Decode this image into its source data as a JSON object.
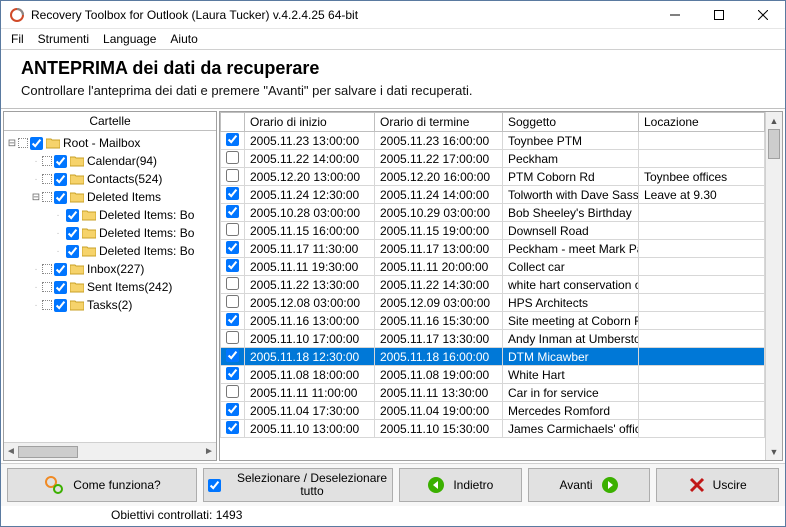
{
  "window": {
    "title": "Recovery Toolbox for Outlook (Laura Tucker) v.4.2.4.25 64-bit"
  },
  "menu": {
    "file": "Fil",
    "tools": "Strumenti",
    "language": "Language",
    "help": "Aiuto"
  },
  "header": {
    "title": "ANTEPRIMA dei dati da recuperare",
    "subtitle": "Controllare l'anteprima dei dati e premere \"Avanti\" per salvare i dati recuperati."
  },
  "tree": {
    "header": "Cartelle",
    "root": "Root - Mailbox",
    "items": [
      {
        "label": "Calendar",
        "count": "  (94)",
        "indent": 1
      },
      {
        "label": "Contacts",
        "count": "  (524)",
        "indent": 1
      },
      {
        "label": "Deleted Items",
        "count": "",
        "indent": 1,
        "expandable": true
      },
      {
        "label": "Deleted Items: Bo",
        "count": "",
        "indent": 2
      },
      {
        "label": "Deleted Items: Bo",
        "count": "",
        "indent": 2
      },
      {
        "label": "Deleted Items: Bo",
        "count": "",
        "indent": 2
      },
      {
        "label": "Inbox",
        "count": "  (227)",
        "indent": 1
      },
      {
        "label": "Sent Items",
        "count": "  (242)",
        "indent": 1
      },
      {
        "label": "Tasks",
        "count": "  (2)",
        "indent": 1
      }
    ]
  },
  "grid": {
    "cols": {
      "start": "Orario di inizio",
      "end": "Orario di termine",
      "subject": "Soggetto",
      "location": "Locazione"
    },
    "rows": [
      {
        "chk": true,
        "start": "2005.11.23 13:00:00",
        "end": "2005.11.23 16:00:00",
        "subject": "Toynbee PTM",
        "location": ""
      },
      {
        "chk": false,
        "start": "2005.11.22 14:00:00",
        "end": "2005.11.22 17:00:00",
        "subject": "Peckham",
        "location": ""
      },
      {
        "chk": false,
        "start": "2005.12.20 13:00:00",
        "end": "2005.12.20 16:00:00",
        "subject": "PTM Coborn Rd",
        "location": "Toynbee offices"
      },
      {
        "chk": true,
        "start": "2005.11.24 12:30:00",
        "end": "2005.11.24 14:00:00",
        "subject": "Tolworth with Dave Sasse",
        "location": "Leave at 9.30"
      },
      {
        "chk": true,
        "start": "2005.10.28 03:00:00",
        "end": "2005.10.29 03:00:00",
        "subject": "Bob Sheeley's Birthday",
        "location": ""
      },
      {
        "chk": false,
        "start": "2005.11.15 16:00:00",
        "end": "2005.11.15 19:00:00",
        "subject": "Downsell Road",
        "location": ""
      },
      {
        "chk": true,
        "start": "2005.11.17 11:30:00",
        "end": "2005.11.17 13:00:00",
        "subject": "Peckham - meet  Mark Pay",
        "location": ""
      },
      {
        "chk": true,
        "start": "2005.11.11 19:30:00",
        "end": "2005.11.11 20:00:00",
        "subject": "Collect car",
        "location": ""
      },
      {
        "chk": false,
        "start": "2005.11.22 13:30:00",
        "end": "2005.11.22 14:30:00",
        "subject": "white hart conservation o",
        "location": ""
      },
      {
        "chk": false,
        "start": "2005.12.08 03:00:00",
        "end": "2005.12.09 03:00:00",
        "subject": "HPS Architects",
        "location": ""
      },
      {
        "chk": true,
        "start": "2005.11.16 13:00:00",
        "end": "2005.11.16 15:30:00",
        "subject": "Site meeting at Coborn Rd",
        "location": ""
      },
      {
        "chk": false,
        "start": "2005.11.10 17:00:00",
        "end": "2005.11.17 13:30:00",
        "subject": "Andy Inman at Umberston",
        "location": ""
      },
      {
        "chk": true,
        "start": "2005.11.18 12:30:00",
        "end": "2005.11.18 16:00:00",
        "subject": "DTM Micawber",
        "location": "",
        "selected": true
      },
      {
        "chk": true,
        "start": "2005.11.08 18:00:00",
        "end": "2005.11.08 19:00:00",
        "subject": "White Hart",
        "location": ""
      },
      {
        "chk": false,
        "start": "2005.11.11 11:00:00",
        "end": "2005.11.11 13:30:00",
        "subject": "Car in for service",
        "location": ""
      },
      {
        "chk": true,
        "start": "2005.11.04 17:30:00",
        "end": "2005.11.04 19:00:00",
        "subject": "Mercedes Romford",
        "location": ""
      },
      {
        "chk": true,
        "start": "2005.11.10 13:00:00",
        "end": "2005.11.10 15:30:00",
        "subject": "James Carmichaels' office",
        "location": ""
      }
    ]
  },
  "buttons": {
    "how": "Come funziona?",
    "select_all": "Selezionare / Deselezionare tutto",
    "back": "Indietro",
    "next": "Avanti",
    "exit": "Uscire"
  },
  "status": {
    "text": "Obiettivi controllati: 1493"
  },
  "colors": {
    "selection": "#0078d7",
    "nav_green": "#3bb000",
    "exit_red": "#c11717",
    "gear_orange": "#f08a24"
  }
}
